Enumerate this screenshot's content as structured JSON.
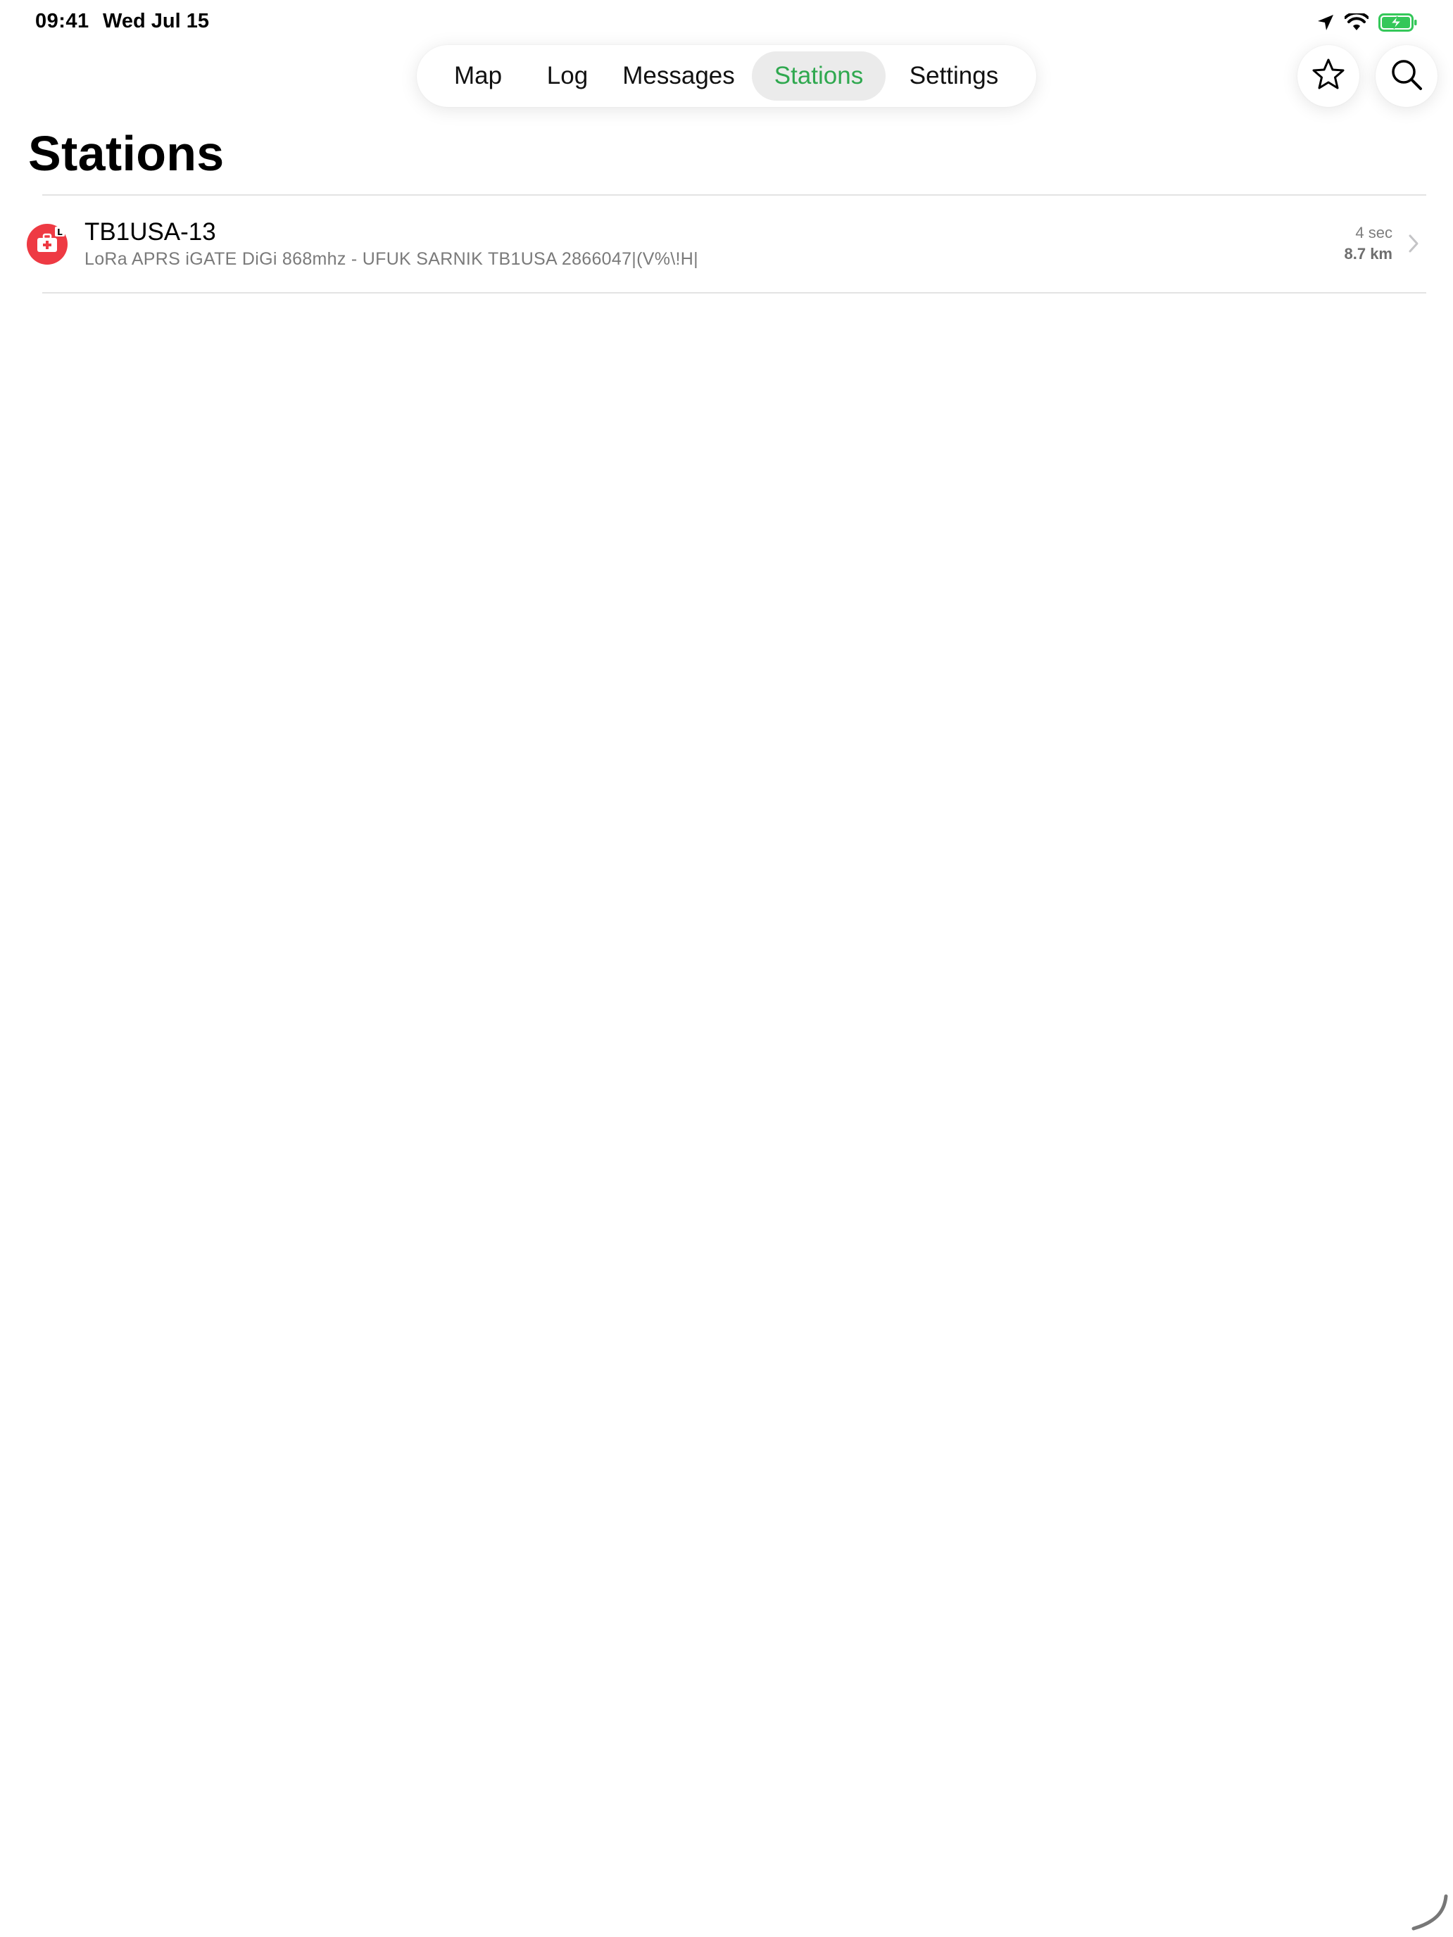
{
  "status_bar": {
    "time": "09:41",
    "date": "Wed Jul 15",
    "icons": [
      "location-arrow-icon",
      "wifi-icon",
      "battery-charging-icon"
    ]
  },
  "tabs": [
    {
      "label": "Map",
      "active": false
    },
    {
      "label": "Log",
      "active": false
    },
    {
      "label": "Messages",
      "active": false
    },
    {
      "label": "Stations",
      "active": true
    },
    {
      "label": "Settings",
      "active": false
    }
  ],
  "toolbar": {
    "favorites_icon": "star-icon",
    "search_icon": "search-icon"
  },
  "page": {
    "title": "Stations"
  },
  "stations": [
    {
      "callsign": "TB1USA-13",
      "comment": "LoRa APRS iGATE DiGi 868mhz - UFUK SARNIK TB1USA 2866047|(V%\\!H|",
      "age": "4 sec",
      "distance": "8.7 km",
      "icon": "first-aid-kit-icon"
    }
  ],
  "colors": {
    "accent": "#2fa84f",
    "station_icon_bg": "#ee3a43",
    "battery": "#34c759"
  }
}
